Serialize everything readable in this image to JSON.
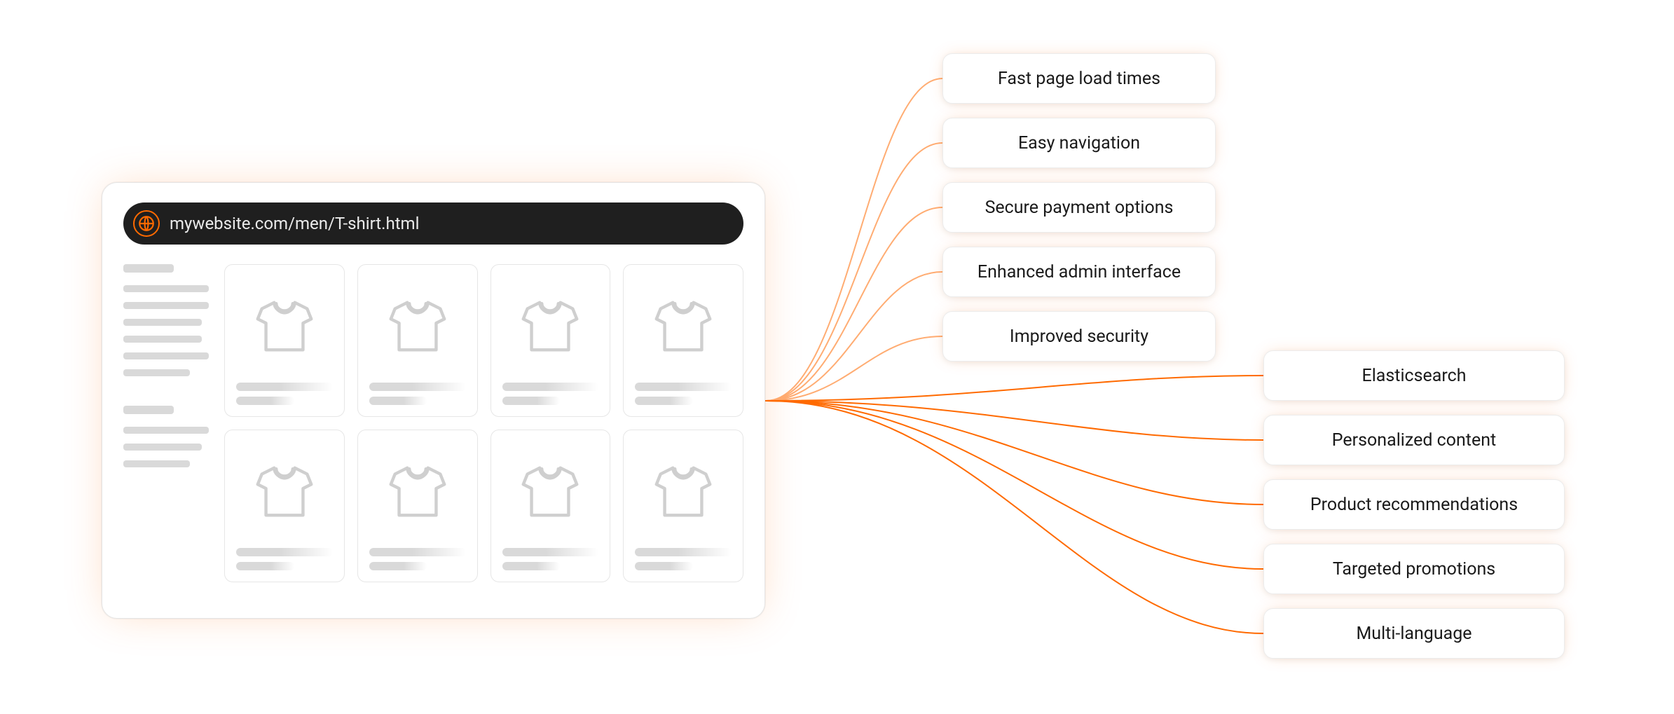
{
  "browser": {
    "url": "mywebsite.com/men/T-shirt.html"
  },
  "groups": {
    "top": [
      "Fast page load times",
      "Easy navigation",
      "Secure payment options",
      "Enhanced admin interface",
      "Improved security"
    ],
    "bottom": [
      "Elasticsearch",
      "Personalized content",
      "Product recommendations",
      "Targeted promotions",
      "Multi-language"
    ]
  },
  "colors": {
    "accent": "#ff6a00"
  }
}
